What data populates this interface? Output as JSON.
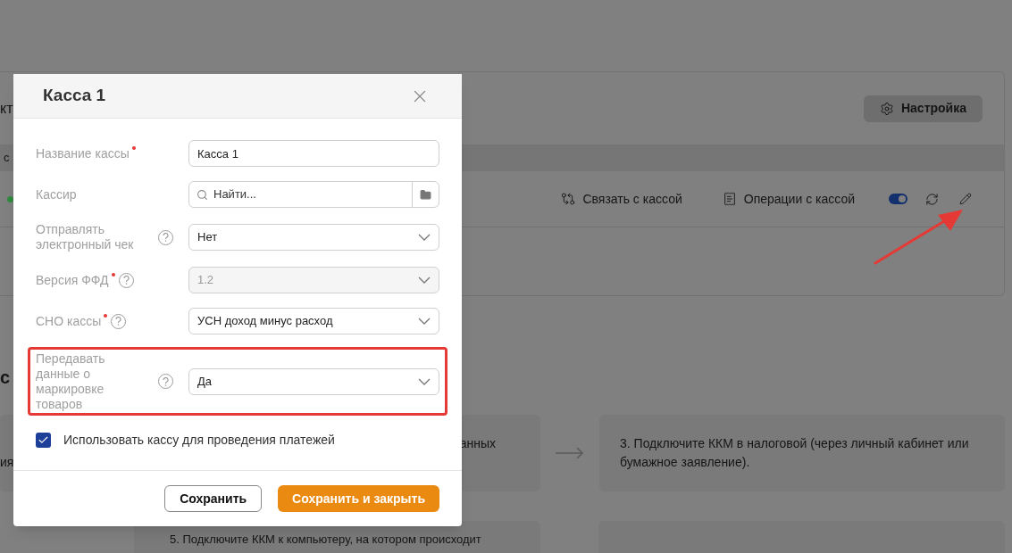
{
  "page": {
    "panel": {
      "title_fragment": "кт",
      "settings_button": "Настройка",
      "column_fragment": "с",
      "device": {
        "color": "#2e8b3e",
        "actions": [
          "Связать с кассой",
          "Операции с кассой"
        ],
        "enabled": true
      }
    },
    "section_title_fragment": "с",
    "steps": [
      {
        "fragments": [
          "анных",
          "ия"
        ]
      },
      {
        "text": "3. Подключите ККМ в налоговой (через личный кабинет или бумажное заявление)."
      },
      {
        "text": "5. Подключите ККМ к компьютеру, на котором происходит"
      }
    ]
  },
  "dialog": {
    "title": "Касса 1",
    "fields": [
      {
        "kind": "text",
        "label": "Название кассы",
        "required": true,
        "help": false,
        "value": "Касса 1",
        "disabled": false,
        "highlighted": false
      },
      {
        "kind": "search",
        "label": "Кассир",
        "required": false,
        "help": false,
        "placeholder": "Найти...",
        "disabled": false,
        "highlighted": false
      },
      {
        "kind": "select",
        "label": "Отправлять электронный чек",
        "required": false,
        "help": true,
        "value": "Нет",
        "disabled": false,
        "highlighted": false
      },
      {
        "kind": "select",
        "label": "Версия ФФД",
        "required": true,
        "help": true,
        "value": "1.2",
        "disabled": true,
        "highlighted": false
      },
      {
        "kind": "select",
        "label": "СНО кассы",
        "required": true,
        "help": true,
        "value": "УСН доход минус расход",
        "disabled": false,
        "highlighted": false
      },
      {
        "kind": "select",
        "label": "Передавать данные о маркировке товаров",
        "required": false,
        "help": true,
        "value": "Да",
        "disabled": false,
        "highlighted": true
      }
    ],
    "checkbox": {
      "label": "Использовать кассу для проведения платежей",
      "checked": true
    },
    "buttons": [
      {
        "label": "Сохранить",
        "kind": "secondary"
      },
      {
        "label": "Сохранить и закрыть",
        "kind": "primary"
      }
    ]
  },
  "annotation": {
    "arrow": true
  }
}
